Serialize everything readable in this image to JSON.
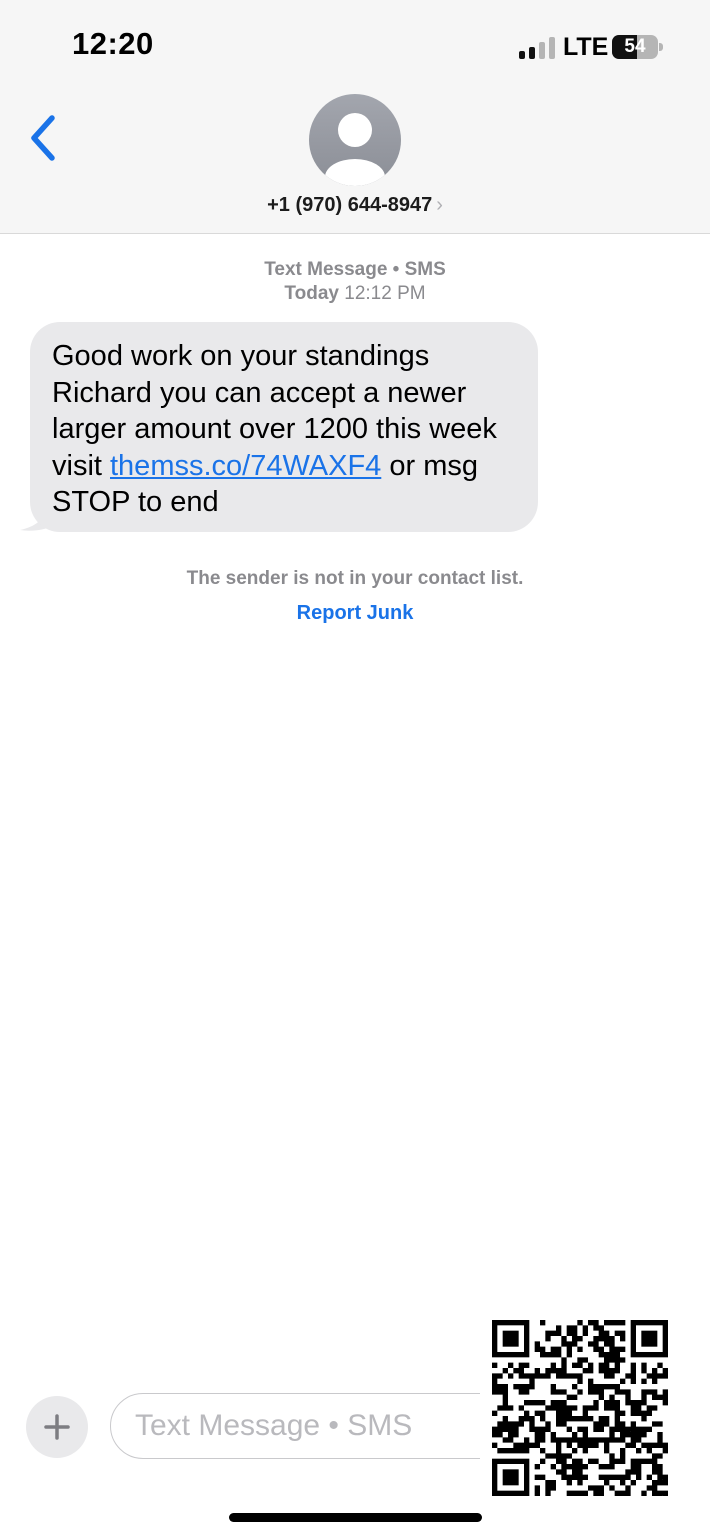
{
  "status_bar": {
    "time": "12:20",
    "network": "LTE",
    "battery": "54",
    "signal_bars_active": 2,
    "signal_bars_total": 4
  },
  "header": {
    "contact": "+1 (970) 644-8947",
    "back_icon": "chevron-left-icon",
    "avatar_icon": "person-silhouette-icon"
  },
  "conversation": {
    "service_label": "Text Message • SMS",
    "date_label": "Today",
    "time_label": "12:12 PM",
    "message": {
      "text_before": "Good work on your standings Richard you can accept a newer larger amount over 1200 this week visit ",
      "link": "themss.co/74WAXF4",
      "text_after": " or msg STOP to end"
    },
    "notice": "The sender is not in your contact list.",
    "report_junk": "Report Junk"
  },
  "composer": {
    "placeholder": "Text Message • SMS",
    "plus_icon": "plus-icon"
  },
  "colors": {
    "accent": "#1a73e8",
    "bubble": "#e9e9eb",
    "secondary_text": "#8a8a8e"
  }
}
